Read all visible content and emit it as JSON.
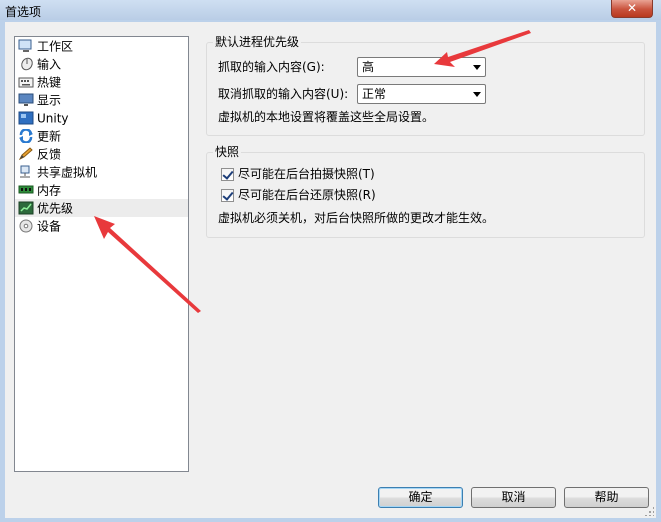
{
  "window": {
    "title": "首选项",
    "close_glyph": "✕"
  },
  "nav": {
    "items": [
      {
        "label": "工作区",
        "icon": "workspace-icon",
        "selected": false
      },
      {
        "label": "输入",
        "icon": "input-icon",
        "selected": false
      },
      {
        "label": "热键",
        "icon": "hotkey-icon",
        "selected": false
      },
      {
        "label": "显示",
        "icon": "display-icon",
        "selected": false
      },
      {
        "label": "Unity",
        "icon": "unity-icon",
        "selected": false
      },
      {
        "label": "更新",
        "icon": "update-icon",
        "selected": false
      },
      {
        "label": "反馈",
        "icon": "feedback-icon",
        "selected": false
      },
      {
        "label": "共享虚拟机",
        "icon": "shared-vm-icon",
        "selected": false
      },
      {
        "label": "内存",
        "icon": "memory-icon",
        "selected": false
      },
      {
        "label": "优先级",
        "icon": "priority-icon",
        "selected": true
      },
      {
        "label": "设备",
        "icon": "devices-icon",
        "selected": false
      }
    ]
  },
  "priority": {
    "group_title": "默认进程优先级",
    "grabbed_label": "抓取的输入内容(G):",
    "grabbed_value": "高",
    "ungrabbed_label": "取消抓取的输入内容(U):",
    "ungrabbed_value": "正常",
    "note": "虚拟机的本地设置将覆盖这些全局设置。"
  },
  "snapshots": {
    "group_title": "快照",
    "bg_snapshot_label": "尽可能在后台拍摄快照(T)",
    "bg_snapshot_checked": true,
    "bg_restore_label": "尽可能在后台还原快照(R)",
    "bg_restore_checked": true,
    "note": "虚拟机必须关机，对后台快照所做的更改才能生效。"
  },
  "buttons": {
    "ok": "确定",
    "cancel": "取消",
    "help": "帮助"
  },
  "colors": {
    "annotation_arrow": "#e8393c",
    "selected_row": "#ececec",
    "titlebar": "#c3d6ee"
  }
}
